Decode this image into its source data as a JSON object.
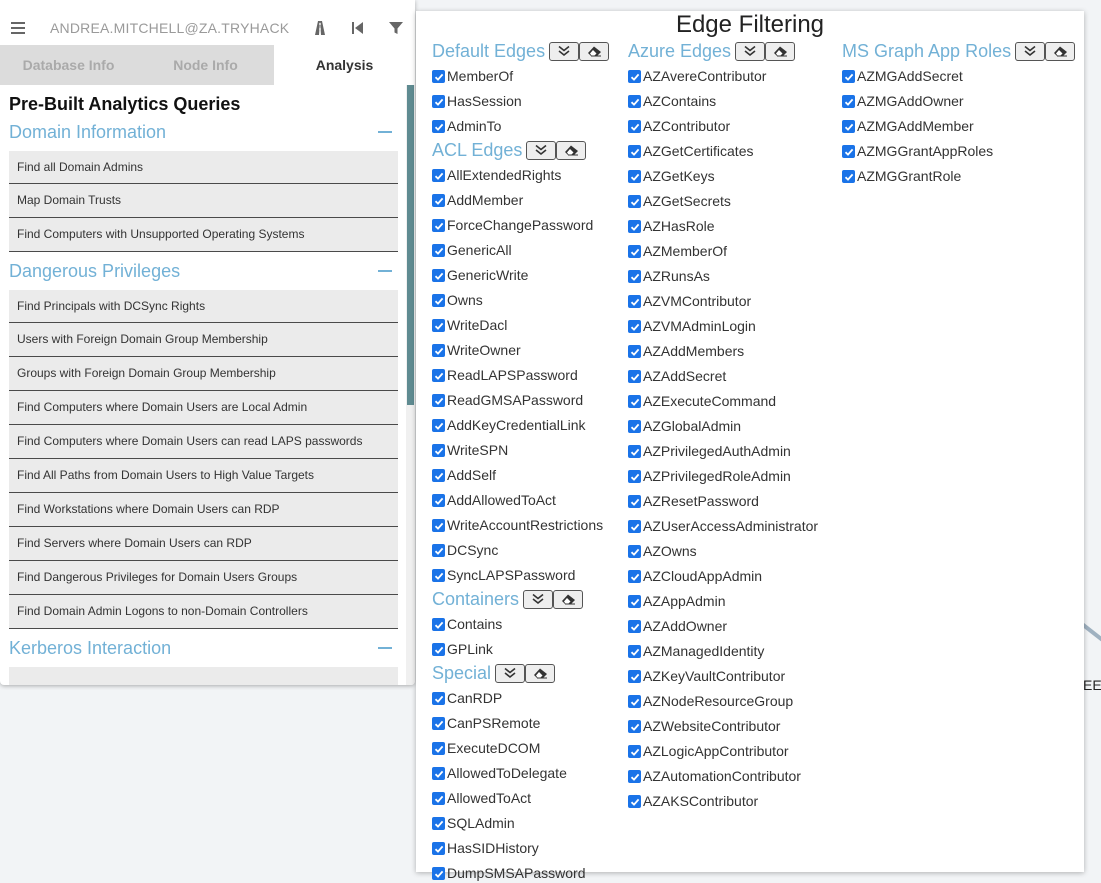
{
  "topbar": {
    "user": "ANDREA.MITCHELL@ZA.TRYHACK"
  },
  "tabs": [
    {
      "label": "Database Info"
    },
    {
      "label": "Node Info"
    },
    {
      "label": "Analysis"
    }
  ],
  "analysis": {
    "heading": "Pre-Built Analytics Queries",
    "sections": [
      {
        "title": "Domain Information",
        "queries": [
          "Find all Domain Admins",
          "Map Domain Trusts",
          "Find Computers with Unsupported Operating Systems"
        ]
      },
      {
        "title": "Dangerous Privileges",
        "queries": [
          "Find Principals with DCSync Rights",
          "Users with Foreign Domain Group Membership",
          "Groups with Foreign Domain Group Membership",
          "Find Computers where Domain Users are Local Admin",
          "Find Computers where Domain Users can read LAPS passwords",
          "Find All Paths from Domain Users to High Value Targets",
          "Find Workstations where Domain Users can RDP",
          "Find Servers where Domain Users can RDP",
          "Find Dangerous Privileges for Domain Users Groups",
          "Find Domain Admin Logons to non-Domain Controllers"
        ]
      },
      {
        "title": "Kerberos Interaction",
        "queries": []
      }
    ]
  },
  "edge_filtering": {
    "title": "Edge Filtering",
    "groups": {
      "default": {
        "title": "Default Edges",
        "edges": [
          "MemberOf",
          "HasSession",
          "AdminTo"
        ]
      },
      "acl": {
        "title": "ACL Edges",
        "edges": [
          "AllExtendedRights",
          "AddMember",
          "ForceChangePassword",
          "GenericAll",
          "GenericWrite",
          "Owns",
          "WriteDacl",
          "WriteOwner",
          "ReadLAPSPassword",
          "ReadGMSAPassword",
          "AddKeyCredentialLink",
          "WriteSPN",
          "AddSelf",
          "AddAllowedToAct",
          "WriteAccountRestrictions",
          "DCSync",
          "SyncLAPSPassword"
        ]
      },
      "containers": {
        "title": "Containers",
        "edges": [
          "Contains",
          "GPLink"
        ]
      },
      "special": {
        "title": "Special",
        "edges": [
          "CanRDP",
          "CanPSRemote",
          "ExecuteDCOM",
          "AllowedToDelegate",
          "AllowedToAct",
          "SQLAdmin",
          "HasSIDHistory",
          "DumpSMSAPassword"
        ]
      },
      "azure": {
        "title": "Azure Edges",
        "edges": [
          "AZAvereContributor",
          "AZContains",
          "AZContributor",
          "AZGetCertificates",
          "AZGetKeys",
          "AZGetSecrets",
          "AZHasRole",
          "AZMemberOf",
          "AZRunsAs",
          "AZVMContributor",
          "AZVMAdminLogin",
          "AZAddMembers",
          "AZAddSecret",
          "AZExecuteCommand",
          "AZGlobalAdmin",
          "AZPrivilegedAuthAdmin",
          "AZPrivilegedRoleAdmin",
          "AZResetPassword",
          "AZUserAccessAdministrator",
          "AZOwns",
          "AZCloudAppAdmin",
          "AZAppAdmin",
          "AZAddOwner",
          "AZManagedIdentity",
          "AZKeyVaultContributor",
          "AZNodeResourceGroup",
          "AZWebsiteContributor",
          "AZLogicAppContributor",
          "AZAutomationContributor",
          "AZAKSContributor"
        ]
      },
      "msgraph": {
        "title": "MS Graph App Roles",
        "edges": [
          "AZMGAddSecret",
          "AZMGAddOwner",
          "AZMGAddMember",
          "AZMGGrantAppRoles",
          "AZMGGrantRole"
        ]
      }
    }
  },
  "graph": {
    "partial_label": "EEN"
  },
  "colors": {
    "section_title": "#72b1d6",
    "checkbox": "#1a73e8",
    "tab_inactive": "#dcdcdc",
    "query_bg": "#ebebeb"
  }
}
